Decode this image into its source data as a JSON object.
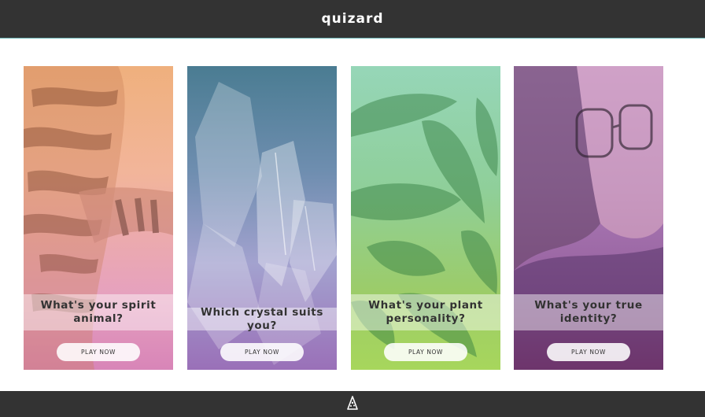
{
  "header": {
    "brand": "quizard"
  },
  "cards": [
    {
      "title": "What's your spirit animal?",
      "button": "PLAY NOW",
      "colors": [
        "#f2b98c",
        "#e39ac0",
        "#c86f92"
      ]
    },
    {
      "title": "Which crystal suits you?",
      "button": "PLAY NOW",
      "colors": [
        "#4f7d92",
        "#8b86b9",
        "#9b6ab0"
      ]
    },
    {
      "title": "What's your plant personality?",
      "button": "PLAY NOW",
      "colors": [
        "#9ad7b7",
        "#92c86b",
        "#9ed45a"
      ]
    },
    {
      "title": "What's your true identity?",
      "button": "PLAY NOW",
      "colors": [
        "#b58ac6",
        "#9e6ba9",
        "#8e3e77"
      ]
    }
  ],
  "footer": {
    "logo_icon": "wizard-hat-icon"
  }
}
